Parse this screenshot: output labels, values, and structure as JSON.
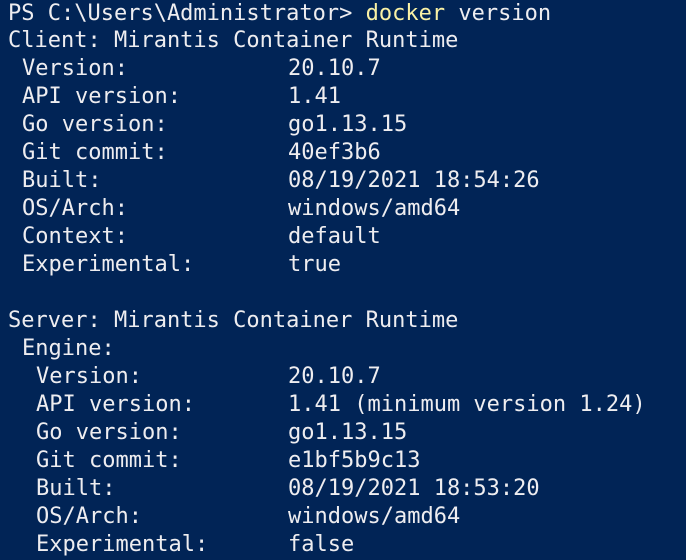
{
  "prompt": {
    "text": "PS C:\\Users\\Administrator> ",
    "command": "docker",
    "args": " version"
  },
  "client": {
    "header": "Client: Mirantis Container Runtime",
    "fields": [
      {
        "label": "Version:",
        "value": "20.10.7"
      },
      {
        "label": "API version:",
        "value": "1.41"
      },
      {
        "label": "Go version:",
        "value": "go1.13.15"
      },
      {
        "label": "Git commit:",
        "value": "40ef3b6"
      },
      {
        "label": "Built:",
        "value": "08/19/2021 18:54:26"
      },
      {
        "label": "OS/Arch:",
        "value": "windows/amd64"
      },
      {
        "label": "Context:",
        "value": "default"
      },
      {
        "label": "Experimental:",
        "value": "true"
      }
    ]
  },
  "server": {
    "header": "Server: Mirantis Container Runtime",
    "engine_label": "Engine:",
    "fields": [
      {
        "label": "Version:",
        "value": "20.10.7"
      },
      {
        "label": "API version:",
        "value": "1.41 (minimum version 1.24)"
      },
      {
        "label": "Go version:",
        "value": "go1.13.15"
      },
      {
        "label": "Git commit:",
        "value": "e1bf5b9c13"
      },
      {
        "label": "Built:",
        "value": "08/19/2021 18:53:20"
      },
      {
        "label": "OS/Arch:",
        "value": "windows/amd64"
      },
      {
        "label": "Experimental:",
        "value": "false"
      }
    ]
  },
  "colors": {
    "background": "#012456",
    "foreground": "#eeedf0",
    "command": "#f9f1a5"
  }
}
